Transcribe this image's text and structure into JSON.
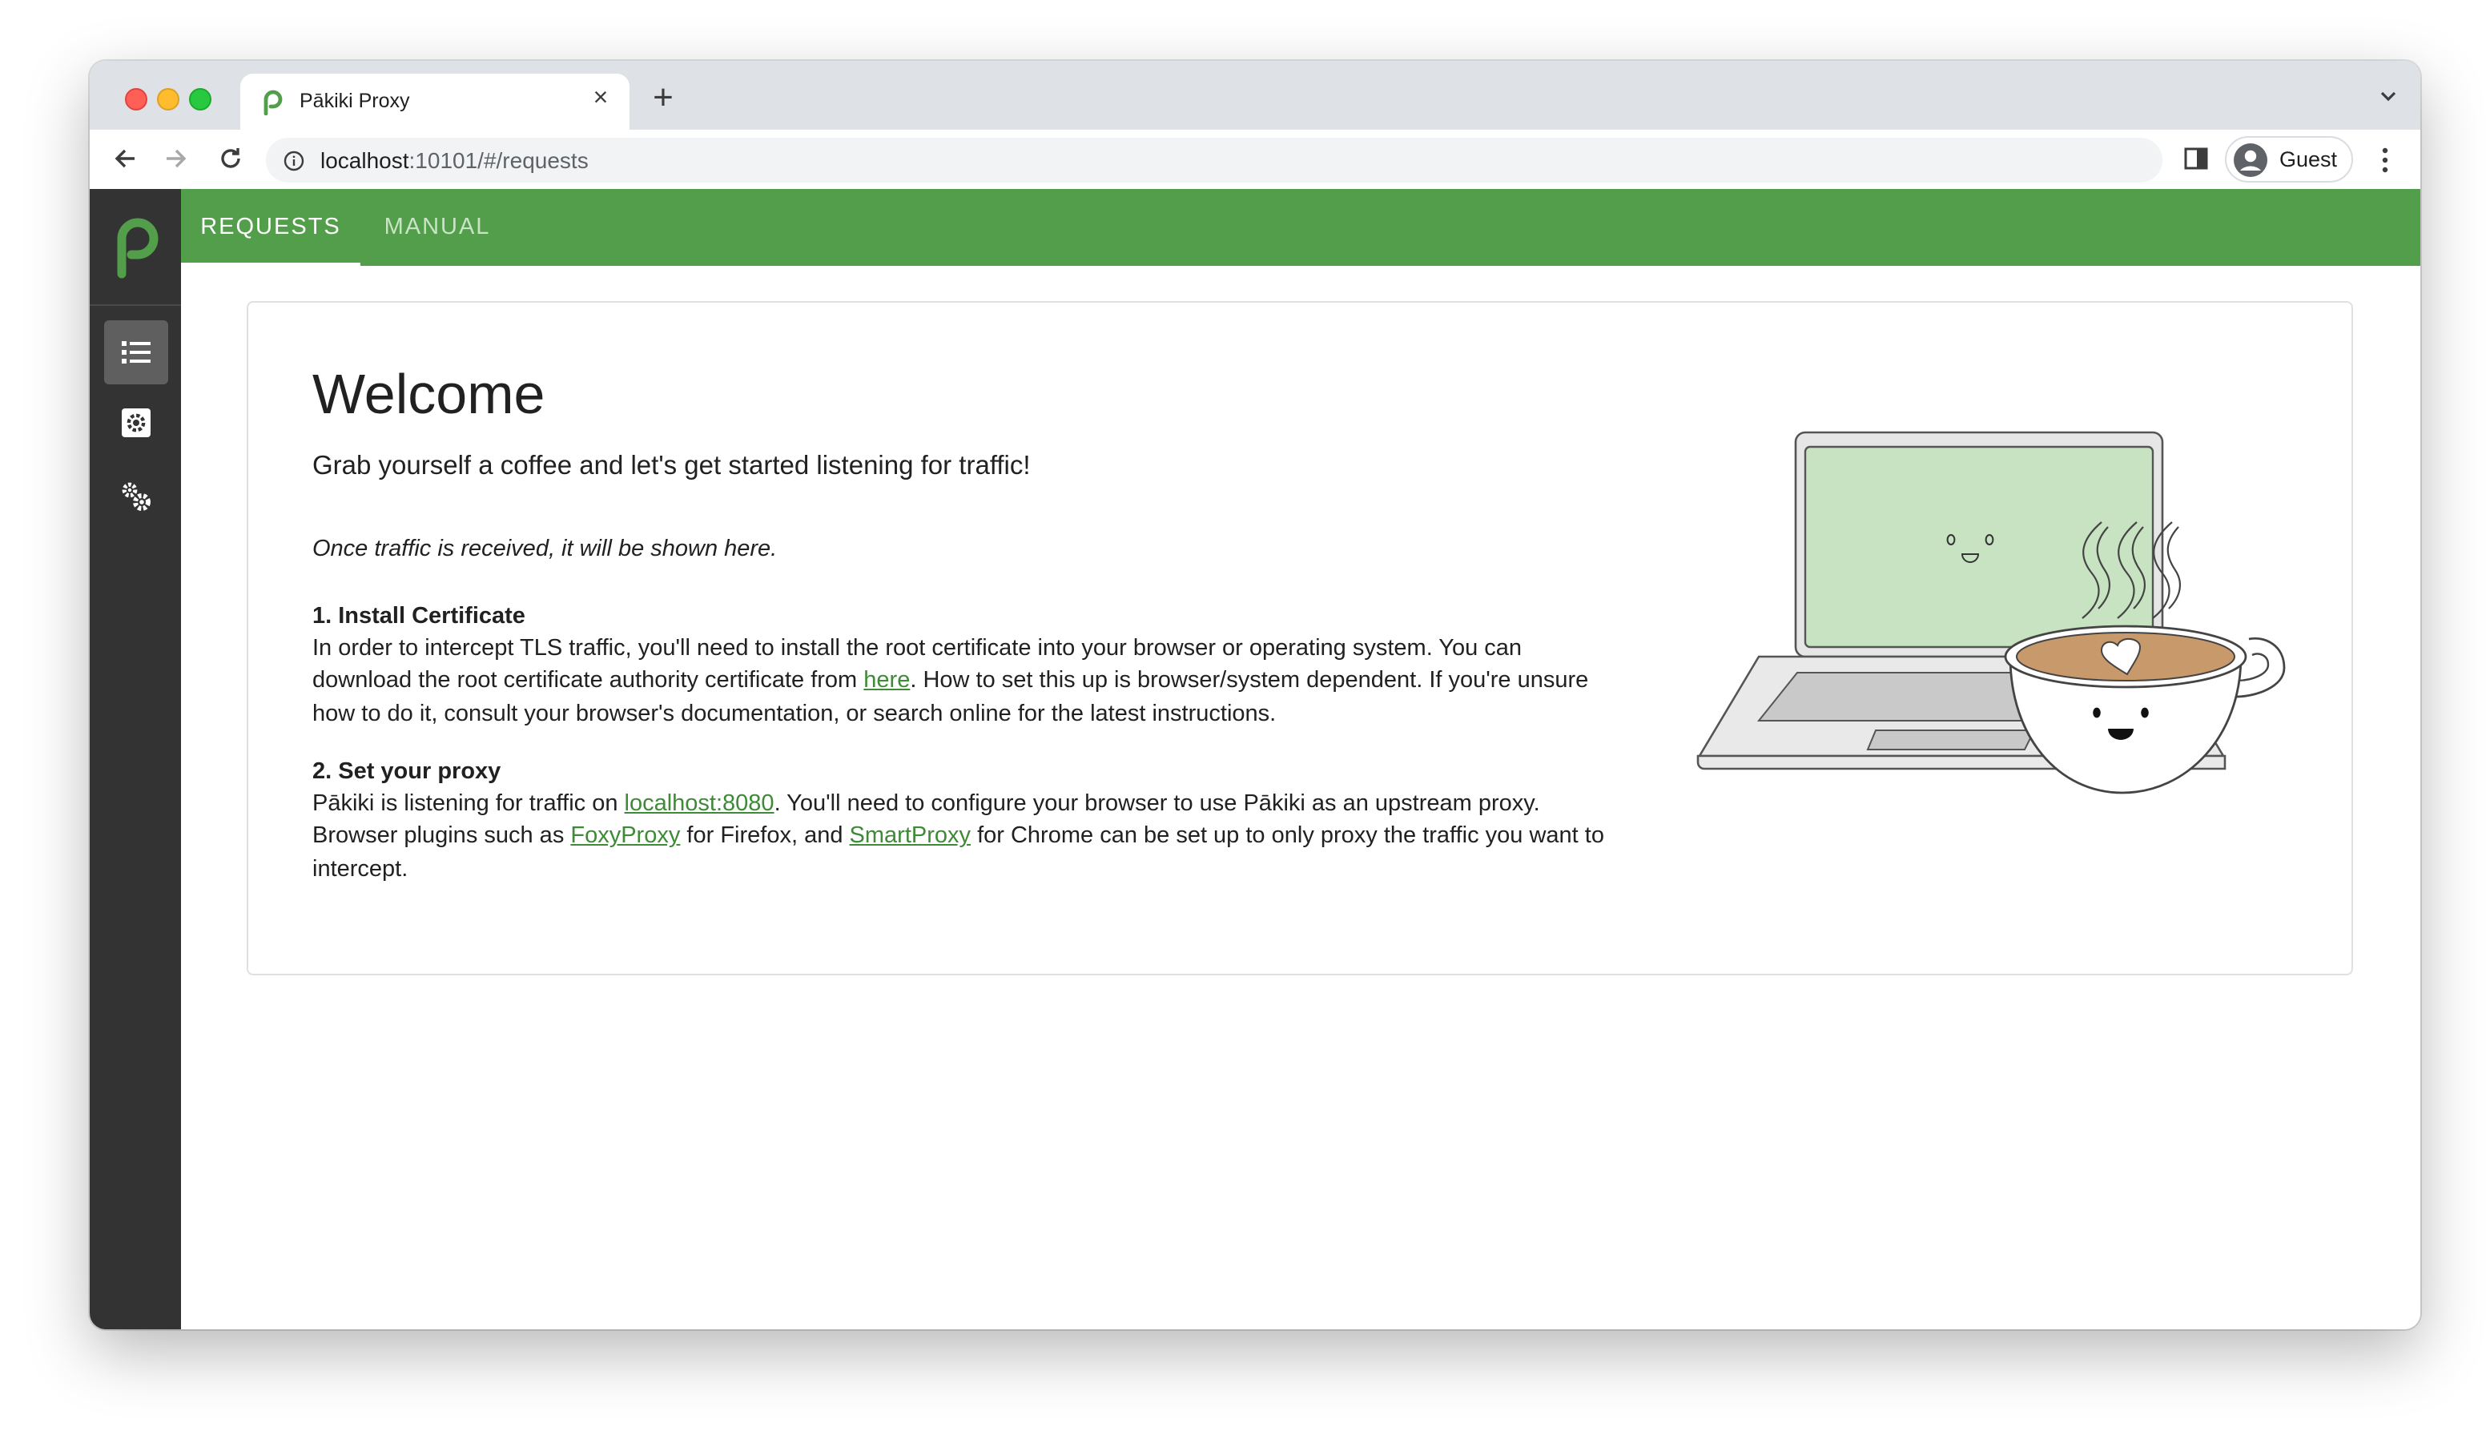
{
  "browser": {
    "tab_title": "Pākiki Proxy",
    "url_host": "localhost",
    "url_rest": ":10101/#/requests",
    "profile_name": "Guest"
  },
  "colors": {
    "brand_green": "#529e4a",
    "rail_bg": "#333333",
    "link_green": "#3e8a37"
  },
  "rail": {
    "items": [
      {
        "icon": "list-icon",
        "active": true
      },
      {
        "icon": "scope-gear-icon",
        "active": false
      },
      {
        "icon": "settings-gears-icon",
        "active": false
      }
    ]
  },
  "topbar": {
    "tabs": [
      {
        "label": "REQUESTS",
        "active": true
      },
      {
        "label": "MANUAL",
        "active": false
      }
    ]
  },
  "welcome": {
    "title": "Welcome",
    "subtitle": "Grab yourself a coffee and let's get started listening for traffic!",
    "note": "Once traffic is received, it will be shown here.",
    "cert": {
      "heading": "1. Install Certificate",
      "text_before": "In order to intercept TLS traffic, you'll need to install the root certificate into your browser or operating system. You can download the root certificate authority certificate from ",
      "link": "here",
      "text_after": ". How to set this up is browser/system dependent. If you're unsure how to do it, consult your browser's documentation, or search online for the latest instructions."
    },
    "proxy": {
      "heading": "2. Set your proxy",
      "text_1": "Pākiki is listening for traffic on ",
      "link_addr": "localhost:8080",
      "text_2": ". You'll need to configure your browser to use Pākiki as an upstream proxy. Browser plugins such as ",
      "link_foxy": "FoxyProxy",
      "text_3": " for Firefox, and ",
      "link_smart": "SmartProxy",
      "text_4": " for Chrome can be set up to only proxy the traffic you want to intercept."
    }
  }
}
